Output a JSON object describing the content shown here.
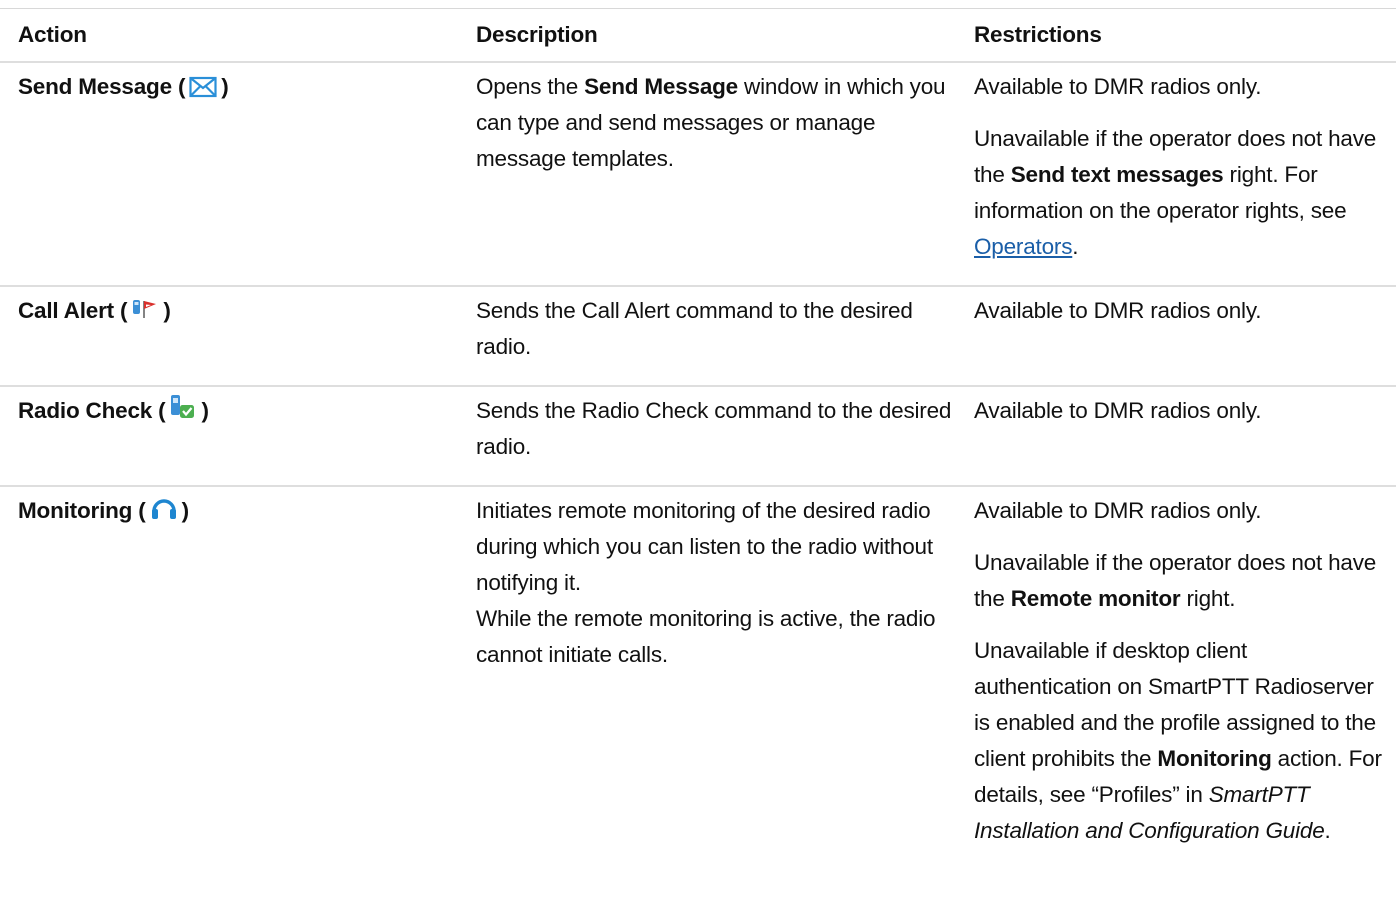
{
  "headers": {
    "action": "Action",
    "description": "Description",
    "restrictions": "Restrictions"
  },
  "rows": [
    {
      "action": "Send Message",
      "icon": "envelope-icon",
      "description": {
        "pre": "Opens the ",
        "bold": "Send Message",
        "post": " window in which you can type and send messages or manage message templates."
      },
      "restrictions": [
        "Available to DMR radios only.",
        {
          "pre": "Unavailable if the operator does not have the ",
          "bold": "Send text messages",
          "mid": " right. For information on the operator rights, see ",
          "link": "Operators",
          "post": "."
        }
      ]
    },
    {
      "action": "Call Alert",
      "icon": "call-alert-flag-icon",
      "description": "Sends the Call Alert command to the desired radio.",
      "restrictions": [
        "Available to DMR radios only."
      ]
    },
    {
      "action": "Radio Check",
      "icon": "radio-check-icon",
      "description": "Sends the Radio Check command to the desired radio.",
      "restrictions": [
        "Available to DMR radios only."
      ]
    },
    {
      "action": "Monitoring",
      "icon": "headphones-icon",
      "description": [
        "Initiates remote monitoring of the desired radio during which you can listen to the radio without notifying it.",
        "While the remote monitoring is active, the radio cannot initiate calls."
      ],
      "restrictions": [
        "Available to DMR radios only.",
        {
          "pre": "Unavailable if the operator does not have the ",
          "bold": "Remote monitor",
          "post": " right."
        },
        {
          "pre": "Unavailable if desktop client authentication on SmartPTT Radioserver is enabled and the profile assigned to the client prohibits the ",
          "bold": "Monitoring",
          "mid": " action. For details, see “Profiles” in ",
          "italic": "SmartPTT Installation and Configuration Guide",
          "post": "."
        }
      ]
    }
  ],
  "colors": {
    "link": "#1a5ea8",
    "envelope": "#2a8fd8",
    "headphones": "#1e86d0",
    "check": "#4caf50",
    "flag": "#d9302c"
  }
}
